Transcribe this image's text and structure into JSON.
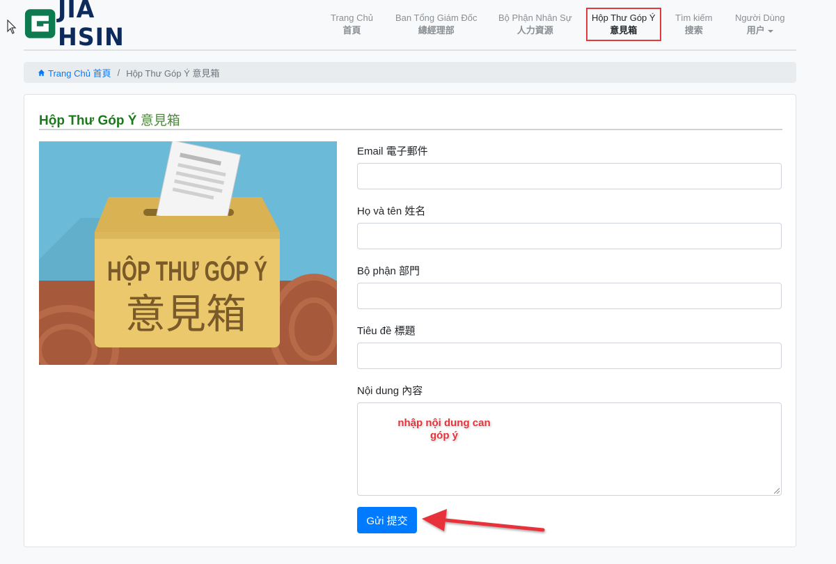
{
  "brand": {
    "name": "JIA HSIN",
    "color": "#0c2b5c",
    "icon_color": "#0e7a50"
  },
  "nav": [
    {
      "vi": "Trang Chủ",
      "zh": "首頁"
    },
    {
      "vi": "Ban Tổng Giám Đốc",
      "zh": "總經理部"
    },
    {
      "vi": "Bộ Phận Nhân Sự",
      "zh": "人力資源"
    },
    {
      "vi": "Hộp Thư Góp Ý",
      "zh": "意見箱"
    },
    {
      "vi": "Tìm kiếm",
      "zh": "搜索"
    },
    {
      "vi": "Người Dùng",
      "zh": "用户"
    }
  ],
  "breadcrumb": {
    "home": "Trang Chủ 首頁",
    "current": "Hộp Thư Góp Ý 意見箱"
  },
  "card": {
    "title_vi": "Hộp Thư Góp Ý",
    "title_zh": "意見箱"
  },
  "illustration": {
    "line1": "HỘP THƯ GÓP Ý",
    "line2": "意見箱"
  },
  "form": {
    "email_label": "Email 電子郵件",
    "name_label": "Họ và tên 姓名",
    "department_label": "Bộ phận 部門",
    "subject_label": "Tiêu đề 標題",
    "content_label": "Nội dung 內容",
    "content_hint": "nhập nội dung can góp ý",
    "submit_label": "Gửi 提交"
  },
  "colors": {
    "accent": "#007bff",
    "highlight": "#e0393e",
    "title_green": "#1a7a1a"
  }
}
